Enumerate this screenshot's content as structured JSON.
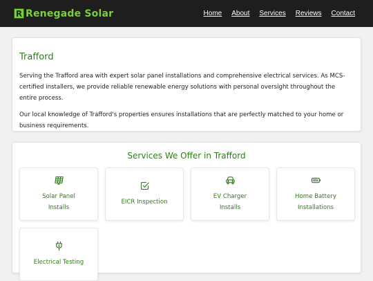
{
  "header": {
    "logo_letter": "R",
    "brand": "Renegade Solar",
    "nav": [
      "Home",
      "About",
      "Services",
      "Reviews",
      "Contact"
    ]
  },
  "intro": {
    "title": "Trafford",
    "paragraphs": [
      "Serving the Trafford area with expert solar panel installations and comprehensive electrical services. As MCS-certified installers, we provide reliable renewable energy solutions with personal oversight throughout the entire process.",
      "Our local knowledge of Trafford's properties ensures installations that are perfectly matched to your home or business requirements."
    ]
  },
  "services": {
    "title": "Services We Offer in Trafford",
    "items": [
      {
        "label": "Solar Panel Installs",
        "icon": "solar-panel-icon"
      },
      {
        "label": "EICR Inspection",
        "icon": "check-square-icon"
      },
      {
        "label": "EV Charger Installs",
        "icon": "car-icon"
      },
      {
        "label": "Home Battery Installations",
        "icon": "battery-icon"
      },
      {
        "label": "Electrical Testing",
        "icon": "plug-icon"
      }
    ]
  },
  "colors": {
    "accent": "#2e7d1a",
    "brand_green": "#7ad03a",
    "header_bg": "#1e1e1e"
  }
}
